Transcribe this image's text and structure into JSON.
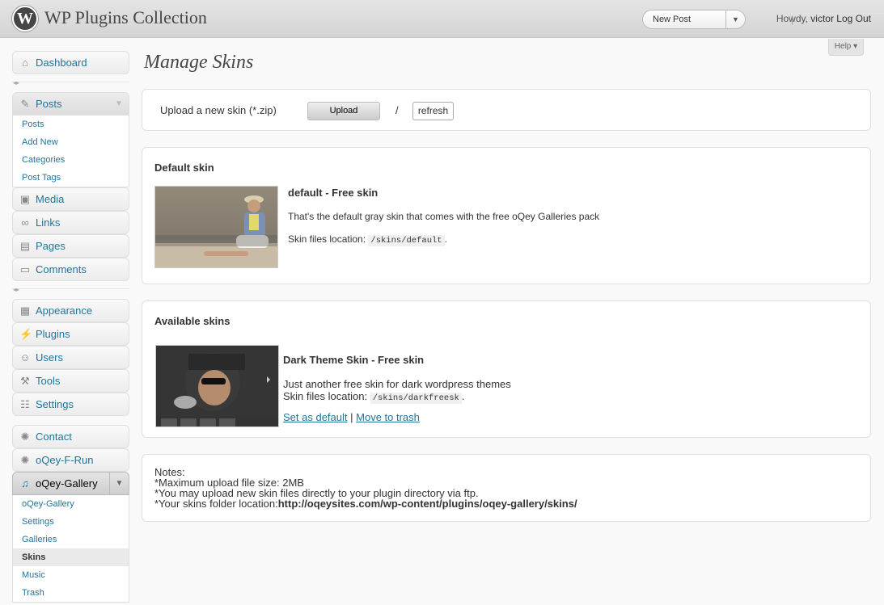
{
  "header": {
    "logo_letter": "W",
    "site_title": "WP Plugins Collection",
    "favorite_action": "New Post",
    "greeting": "Howdy,",
    "username": "victor",
    "logout": "Log Out"
  },
  "menu": {
    "dashboard": "Dashboard",
    "posts": "Posts",
    "posts_sub": [
      "Posts",
      "Add New",
      "Categories",
      "Post Tags"
    ],
    "media": "Media",
    "links": "Links",
    "pages": "Pages",
    "comments": "Comments",
    "appearance": "Appearance",
    "plugins": "Plugins",
    "users": "Users",
    "tools": "Tools",
    "settings": "Settings",
    "contact": "Contact",
    "oqey_frun": "oQey-F-Run",
    "oqey_gallery": "oQey-Gallery",
    "gallery_sub": [
      "oQey-Gallery",
      "Settings",
      "Galleries",
      "Skins",
      "Music",
      "Trash"
    ]
  },
  "help": "Help",
  "page_title": "Manage Skins",
  "upload": {
    "label": "Upload a new skin (*.zip)",
    "button": "Upload",
    "slash": "/",
    "refresh": "refresh"
  },
  "default_skin": {
    "heading": "Default skin",
    "name": "default - Free skin",
    "description": "That's the default gray skin that comes with the free oQey Galleries pack",
    "location_label": "Skin files location:",
    "location": "/skins/default",
    "period": "."
  },
  "available_skins": {
    "heading": "Available skins",
    "name": "Dark Theme Skin - Free skin",
    "description": "Just another free skin for dark wordpress themes",
    "location_label": "Skin files location:",
    "location": "/skins/darkfreesk",
    "period": ".",
    "set_default": "Set as default",
    "divider": "|",
    "move_trash": "Move to trash"
  },
  "notes": {
    "title": "Notes:",
    "line1": "*Maximum upload file size: 2MB",
    "line2": "*You may upload new skin files directly to your plugin directory via ftp.",
    "line3_label": "*Your skins folder location:",
    "line3_value": "http://oqeysites.com/wp-content/plugins/oqey-gallery/skins/"
  },
  "colors": {
    "link": "#21759b",
    "header_bg": "#d4d4d4"
  }
}
